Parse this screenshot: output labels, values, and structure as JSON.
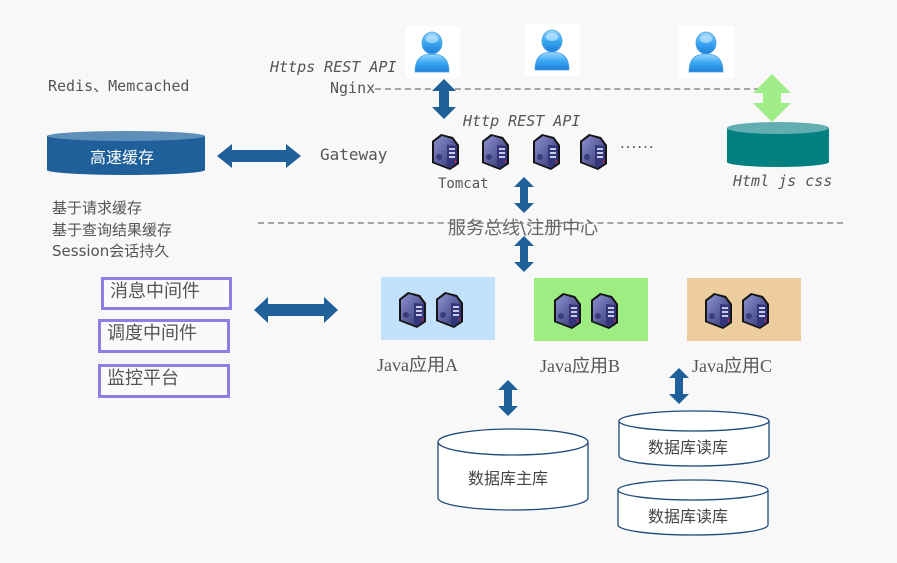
{
  "cache": {
    "tech_label": "Redis、Memcached",
    "name": "高速缓存",
    "features": [
      "基于请求缓存",
      "基于查询结果缓存",
      "Session会话持久"
    ]
  },
  "gateway": {
    "label": "Gateway",
    "https_label": "Https REST API",
    "nginx_label": "Nginx",
    "http_label": "Http REST API",
    "tomcat_label": "Tomcat",
    "ellipsis": "······"
  },
  "static": {
    "label": "Html js css"
  },
  "bus": {
    "label": "服务总线\\注册中心"
  },
  "middleware": {
    "items": [
      "消息中间件",
      "调度中间件",
      "监控平台"
    ]
  },
  "apps": [
    {
      "label": "Java应用A",
      "color": "#c1e1fd"
    },
    {
      "label": "Java应用B",
      "color": "#9ded83"
    },
    {
      "label": "Java应用C",
      "color": "#edcd9d"
    }
  ],
  "databases": {
    "master": "数据库主库",
    "replicas": [
      "数据库读库",
      "数据库读库"
    ]
  },
  "colors": {
    "arrow": "#1f5f9a",
    "static_arrow": "#a0ec86",
    "cache_db": "#1f5f9a",
    "static_db": "#008080",
    "middleware_border": "#8f7ee6"
  }
}
